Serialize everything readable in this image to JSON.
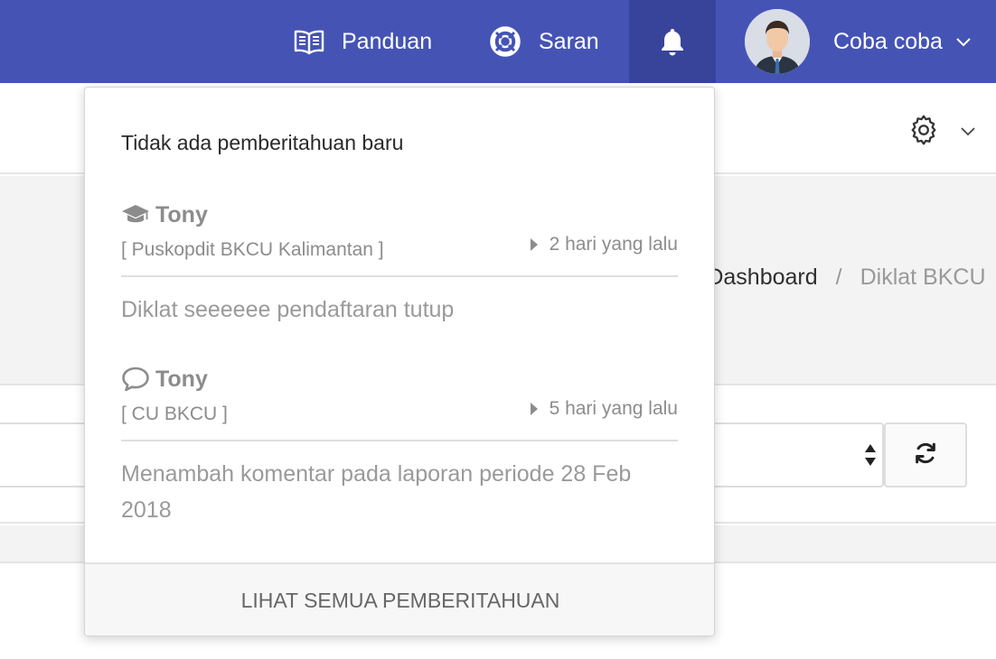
{
  "navbar": {
    "guide_label": "Panduan",
    "feedback_label": "Saran",
    "user_name": "Coba coba",
    "accent_color": "#4554b4"
  },
  "breadcrumb": {
    "separator_lead": "-",
    "home": "Dashboard",
    "separator": "/",
    "current": "Diklat BKCU"
  },
  "notifications": {
    "title": "Tidak ada pemberitahuan baru",
    "items": [
      {
        "icon": "graduation-cap-icon",
        "name": "Tony",
        "org": "[ Puskopdit BKCU Kalimantan ]",
        "time": "2 hari yang lalu",
        "message": "Diklat seeeeee pendaftaran tutup"
      },
      {
        "icon": "comment-icon",
        "name": "Tony",
        "org": "[ CU BKCU ]",
        "time": "5 hari yang lalu",
        "message": "Menambah komentar pada laporan periode 28 Feb 2018"
      }
    ],
    "footer_label": "LIHAT SEMUA PEMBERITAHUAN"
  }
}
